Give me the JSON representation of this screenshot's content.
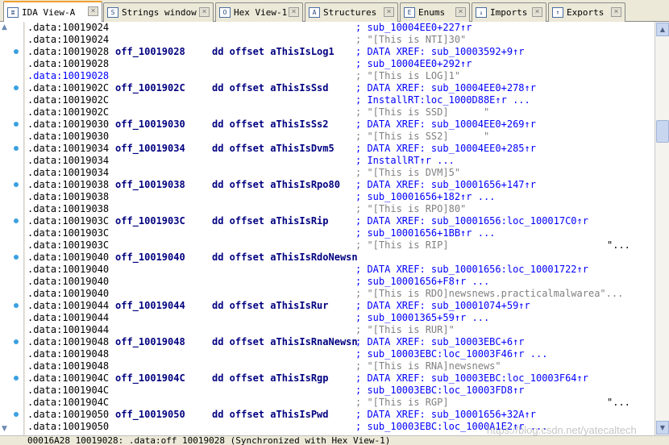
{
  "tabs": [
    {
      "label": "IDA View-A",
      "icon": "ida-view-icon",
      "active": true
    },
    {
      "label": "Strings window",
      "icon": "strings-icon",
      "active": false
    },
    {
      "label": "Hex View-1",
      "icon": "hex-view-icon",
      "active": false
    },
    {
      "label": "Structures",
      "icon": "structures-icon",
      "active": false
    },
    {
      "label": "Enums",
      "icon": "enums-icon",
      "active": false
    },
    {
      "label": "Imports",
      "icon": "imports-icon",
      "active": false
    },
    {
      "label": "Exports",
      "icon": "exports-icon",
      "active": false
    }
  ],
  "rows": [
    {
      "addr": ".data:10019024",
      "comment": "; sub_10004EE0+227↑r",
      "ctype": "xref"
    },
    {
      "addr": ".data:10019024",
      "comment": "; \"[This is NTI]30\"",
      "ctype": "str"
    },
    {
      "addr": ".data:10019028",
      "name": "off_10019028",
      "instr": "dd offset aThisIsLog1",
      "comment": "; DATA XREF: sub_10003592+9↑r",
      "ctype": "xref"
    },
    {
      "addr": ".data:10019028",
      "comment": "; sub_10004EE0+292↑r",
      "ctype": "xref"
    },
    {
      "addr": ".data:10019028",
      "comment": "; \"[This is LOG]1\"",
      "ctype": "str",
      "highlight": true
    },
    {
      "addr": ".data:1001902C",
      "name": "off_1001902C",
      "instr": "dd offset aThisIsSsd",
      "comment": "; DATA XREF: sub_10004EE0+278↑r",
      "ctype": "xref"
    },
    {
      "addr": ".data:1001902C",
      "comment": "; InstallRT:loc_1000D88E↑r ...",
      "ctype": "xref"
    },
    {
      "addr": ".data:1001902C",
      "comment": "; \"[This is SSD]      \"",
      "ctype": "str"
    },
    {
      "addr": ".data:10019030",
      "name": "off_10019030",
      "instr": "dd offset aThisIsSs2",
      "comment": "; DATA XREF: sub_10004EE0+269↑r",
      "ctype": "xref"
    },
    {
      "addr": ".data:10019030",
      "comment": "; \"[This is SS2]      \"",
      "ctype": "str"
    },
    {
      "addr": ".data:10019034",
      "name": "off_10019034",
      "instr": "dd offset aThisIsDvm5",
      "comment": "; DATA XREF: sub_10004EE0+285↑r",
      "ctype": "xref"
    },
    {
      "addr": ".data:10019034",
      "comment": "; InstallRT↑r ...",
      "ctype": "xref"
    },
    {
      "addr": ".data:10019034",
      "comment": "; \"[This is DVM]5\"",
      "ctype": "str"
    },
    {
      "addr": ".data:10019038",
      "name": "off_10019038",
      "instr": "dd offset aThisIsRpo80",
      "comment": "; DATA XREF: sub_10001656+147↑r",
      "ctype": "xref"
    },
    {
      "addr": ".data:10019038",
      "comment": "; sub_10001656+182↑r ...",
      "ctype": "xref"
    },
    {
      "addr": ".data:10019038",
      "comment": "; \"[This is RPO]80\"",
      "ctype": "str"
    },
    {
      "addr": ".data:1001903C",
      "name": "off_1001903C",
      "instr": "dd offset aThisIsRip",
      "comment": "; DATA XREF: sub_10001656:loc_100017C0↑r",
      "ctype": "xref"
    },
    {
      "addr": ".data:1001903C",
      "comment": "; sub_10001656+1BB↑r ...",
      "ctype": "xref"
    },
    {
      "addr": ".data:1001903C",
      "comment": "; \"[This is RIP]",
      "extra": "\"...",
      "ctype": "str"
    },
    {
      "addr": ".data:10019040",
      "name": "off_10019040",
      "instr": "dd offset aThisIsRdoNewsn",
      "ctype": "none"
    },
    {
      "addr": ".data:10019040",
      "comment": "; DATA XREF: sub_10001656:loc_10001722↑r",
      "ctype": "xref"
    },
    {
      "addr": ".data:10019040",
      "comment": "; sub_10001656+F8↑r ...",
      "ctype": "xref"
    },
    {
      "addr": ".data:10019040",
      "comment": "; \"[This is RDO]newsnews.practicalmalwarea\"...",
      "ctype": "str"
    },
    {
      "addr": ".data:10019044",
      "name": "off_10019044",
      "instr": "dd offset aThisIsRur",
      "comment": "; DATA XREF: sub_10001074+59↑r",
      "ctype": "xref"
    },
    {
      "addr": ".data:10019044",
      "comment": "; sub_10001365+59↑r ...",
      "ctype": "xref"
    },
    {
      "addr": ".data:10019044",
      "comment": "; \"[This is RUR]\"",
      "ctype": "str"
    },
    {
      "addr": ".data:10019048",
      "name": "off_10019048",
      "instr": "dd offset aThisIsRnaNewsn",
      "comment": "; DATA XREF: sub_10003EBC+6↑r",
      "ctype": "xref"
    },
    {
      "addr": ".data:10019048",
      "comment": "; sub_10003EBC:loc_10003F46↑r ...",
      "ctype": "xref"
    },
    {
      "addr": ".data:10019048",
      "comment": "; \"[This is RNA]newsnews\"",
      "ctype": "str"
    },
    {
      "addr": ".data:1001904C",
      "name": "off_1001904C",
      "instr": "dd offset aThisIsRgp",
      "comment": "; DATA XREF: sub_10003EBC:loc_10003F64↑r",
      "ctype": "xref"
    },
    {
      "addr": ".data:1001904C",
      "comment": "; sub_10003EBC:loc_10003FD8↑r",
      "ctype": "xref"
    },
    {
      "addr": ".data:1001904C",
      "comment": "; \"[This is RGP]",
      "extra": "\"...",
      "ctype": "str"
    },
    {
      "addr": ".data:10019050",
      "name": "off_10019050",
      "instr": "dd offset aThisIsPwd",
      "comment": "; DATA XREF: sub_10001656+32A↑r",
      "ctype": "xref"
    },
    {
      "addr": ".data:10019050",
      "comment": "; sub_10003EBC:loc_1000A1E2↑r ...",
      "ctype": "xref"
    }
  ],
  "status": "00016A28 10019028: .data:off_10019028 (Synchronized with Hex View-1)",
  "watermark": "https://blog.csdn.net/yatecaltech",
  "colors": {
    "address": "#000000",
    "highlight_address": "#0000ff",
    "label": "#000080",
    "xref_comment": "#0000ff",
    "string_comment": "#808080",
    "tab_active_accent": "#f0a030"
  }
}
